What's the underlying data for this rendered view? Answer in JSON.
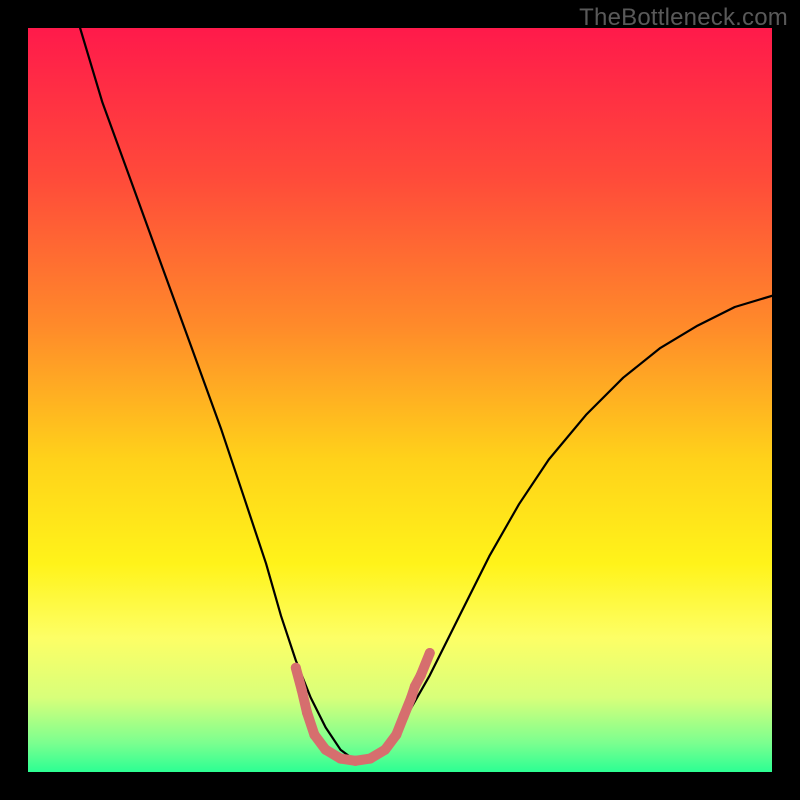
{
  "watermark": "TheBottleneck.com",
  "chart_data": {
    "type": "line",
    "title": "",
    "xlabel": "",
    "ylabel": "",
    "xlim": [
      0,
      100
    ],
    "ylim": [
      0,
      100
    ],
    "grid": false,
    "legend": false,
    "background_gradient": {
      "stops": [
        {
          "offset": 0.0,
          "color": "#ff1a4b"
        },
        {
          "offset": 0.2,
          "color": "#ff4a3a"
        },
        {
          "offset": 0.4,
          "color": "#ff8a2a"
        },
        {
          "offset": 0.58,
          "color": "#ffd21a"
        },
        {
          "offset": 0.72,
          "color": "#fff31a"
        },
        {
          "offset": 0.82,
          "color": "#fdff66"
        },
        {
          "offset": 0.9,
          "color": "#d8ff7a"
        },
        {
          "offset": 0.96,
          "color": "#7dff8f"
        },
        {
          "offset": 1.0,
          "color": "#2cff93"
        }
      ]
    },
    "series": [
      {
        "name": "bottleneck-curve",
        "color": "#000000",
        "x": [
          7,
          10,
          14,
          18,
          22,
          26,
          29,
          32,
          34,
          36,
          38,
          40,
          42,
          44,
          46,
          48,
          50,
          54,
          58,
          62,
          66,
          70,
          75,
          80,
          85,
          90,
          95,
          100
        ],
        "y": [
          100,
          90,
          79,
          68,
          57,
          46,
          37,
          28,
          21,
          15,
          10,
          6,
          3,
          1.5,
          1.5,
          3,
          6,
          13,
          21,
          29,
          36,
          42,
          48,
          53,
          57,
          60,
          62.5,
          64
        ]
      }
    ],
    "markers": {
      "color": "#d66e6e",
      "stroke_width": 10,
      "points": [
        {
          "x": 36.0,
          "y": 14.0
        },
        {
          "x": 36.8,
          "y": 11.0
        },
        {
          "x": 37.5,
          "y": 8.0
        },
        {
          "x": 38.5,
          "y": 5.0
        },
        {
          "x": 40.0,
          "y": 3.0
        },
        {
          "x": 42.0,
          "y": 1.8
        },
        {
          "x": 44.0,
          "y": 1.5
        },
        {
          "x": 46.0,
          "y": 1.8
        },
        {
          "x": 48.0,
          "y": 3.0
        },
        {
          "x": 49.5,
          "y": 5.0
        },
        {
          "x": 50.5,
          "y": 7.5
        },
        {
          "x": 51.5,
          "y": 10.0
        },
        {
          "x": 52.0,
          "y": 11.5
        },
        {
          "x": 52.8,
          "y": 13.0
        },
        {
          "x": 54.0,
          "y": 16.0
        }
      ]
    }
  }
}
